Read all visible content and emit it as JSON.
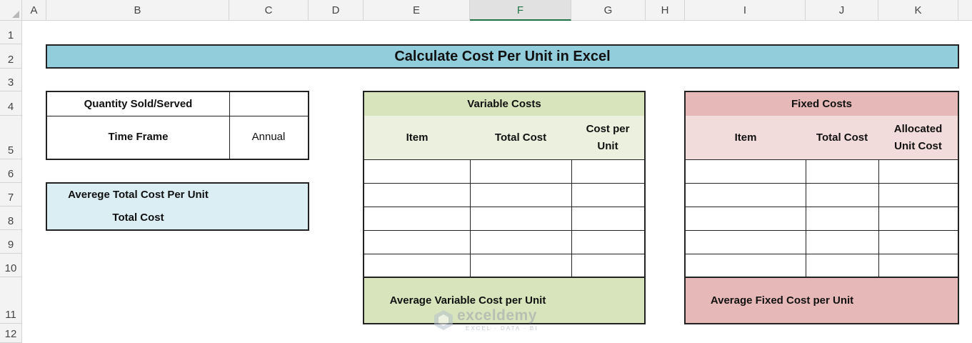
{
  "columns": [
    "A",
    "B",
    "C",
    "D",
    "E",
    "F",
    "G",
    "H",
    "I",
    "J",
    "K"
  ],
  "rows": [
    "1",
    "2",
    "3",
    "4",
    "5",
    "6",
    "7",
    "8",
    "9",
    "10",
    "11",
    "12"
  ],
  "title": "Calculate Cost Per Unit in Excel",
  "info": {
    "quantity_label": "Quantity Sold/Served",
    "quantity_value": "",
    "timeframe_label": "Time Frame",
    "timeframe_value": "Annual"
  },
  "summary": {
    "avg_total_label": "Averege Total Cost Per Unit",
    "total_cost_label": "Total Cost"
  },
  "variable": {
    "title": "Variable Costs",
    "headers": [
      "Item",
      "Total Cost",
      "Cost per Unit"
    ],
    "footer_label": "Average Variable Cost per Unit"
  },
  "fixed": {
    "title": "Fixed Costs",
    "headers": [
      "Item",
      "Total Cost",
      "Allocated Unit Cost"
    ],
    "footer_label": "Average Fixed Cost per Unit"
  },
  "colors": {
    "title_fill": "#92cddc",
    "summary_fill": "#daeef3",
    "variable_header": "#d8e4bc",
    "variable_sub": "#ebf1de",
    "fixed_header": "#e6b8b7",
    "fixed_sub": "#f2dcdb",
    "selected_column": "#217346"
  },
  "watermark": {
    "name": "exceldemy",
    "tagline": "EXCEL · DATA · BI"
  }
}
